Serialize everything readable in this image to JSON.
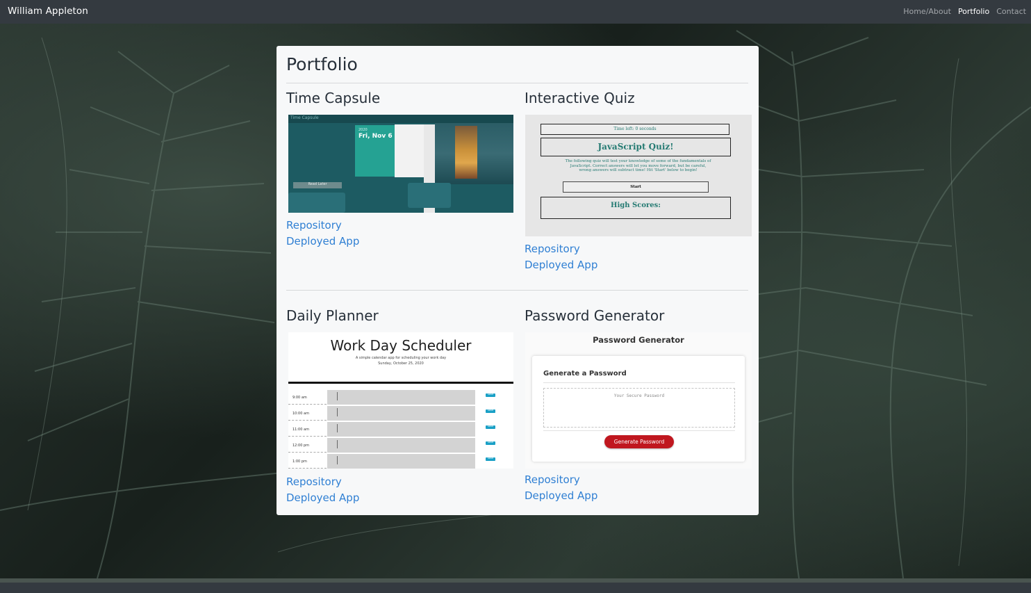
{
  "navbar": {
    "brand": "William Appleton",
    "links": [
      {
        "label": "Home/About",
        "active": false
      },
      {
        "label": "Portfolio",
        "active": true
      },
      {
        "label": "Contact",
        "active": false
      }
    ]
  },
  "page": {
    "title": "Portfolio",
    "projects": [
      {
        "title": "Time Capsule",
        "links": [
          "Repository",
          "Deployed App"
        ],
        "preview": {
          "app_title": "Time Capsule",
          "date_year": "2020",
          "date_day": "Fri, Nov 6",
          "button": "Read Later"
        }
      },
      {
        "title": "Interactive Quiz",
        "links": [
          "Repository",
          "Deployed App"
        ],
        "preview": {
          "timer": "Time left: 0 seconds",
          "heading": "JavaScript Quiz!",
          "description": "The following quiz will test your knowledge of some of the fundamentals of JavaScript. Correct answers will let you move forward, but be careful, wrong answers will subtract time! Hit 'Start' below to begin!",
          "start_button": "Start",
          "scores_heading": "High Scores:"
        }
      },
      {
        "title": "Daily Planner",
        "links": [
          "Repository",
          "Deployed App"
        ],
        "preview": {
          "heading": "Work Day Scheduler",
          "subtitle": "A simple calendar app for scheduling your work day",
          "date": "Sunday, October 25, 2020",
          "hours": [
            "9:00 am",
            "10:00 am",
            "11:00 am",
            "12:00 pm",
            "1:00 pm"
          ],
          "save_label": "Save"
        }
      },
      {
        "title": "Password Generator",
        "links": [
          "Repository",
          "Deployed App"
        ],
        "preview": {
          "heading": "Password Generator",
          "card_title": "Generate a Password",
          "placeholder": "Your Secure Password",
          "button": "Generate Password"
        }
      }
    ]
  },
  "colors": {
    "navbar": "#343a40",
    "link": "#2f7fd3",
    "card": "#f7f8f9"
  }
}
